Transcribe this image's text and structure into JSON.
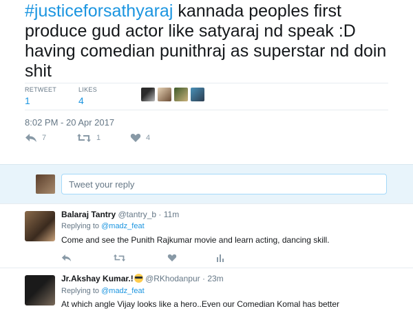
{
  "tweet": {
    "hashtag": "#justiceforsathyaraj",
    "text": " kannada peoples first produce gud actor like satyaraj nd speak :D having comedian punithraj as superstar nd doin shit",
    "stats": {
      "retweet_label": "RETWEET",
      "retweet_count": "1",
      "likes_label": "LIKES",
      "likes_count": "4"
    },
    "timestamp": "8:02 PM - 20 Apr 2017",
    "actions": {
      "reply_count": "7",
      "retweet_count": "1",
      "like_count": "4"
    }
  },
  "reply_box": {
    "placeholder": "Tweet your reply"
  },
  "replies": [
    {
      "name": "Balaraj Tantry",
      "handle": "@tantry_b",
      "separator": "·",
      "time": "11m",
      "replying_prefix": "Replying to",
      "replying_to": "@madz_feat",
      "text": "Come and see the Punith Rajkumar movie and learn acting, dancing skill."
    },
    {
      "name": "Jr.Akshay Kumar.!",
      "handle": "@RKhodanpur",
      "separator": "·",
      "time": "23m",
      "replying_prefix": "Replying to",
      "replying_to": "@madz_feat",
      "text": "At which angle Vijay looks like a hero..Even our Comedian Komal has better"
    }
  ],
  "colors": {
    "accent": "#1b95e0",
    "muted": "#657786",
    "reply_bg": "#e8f4fb"
  }
}
